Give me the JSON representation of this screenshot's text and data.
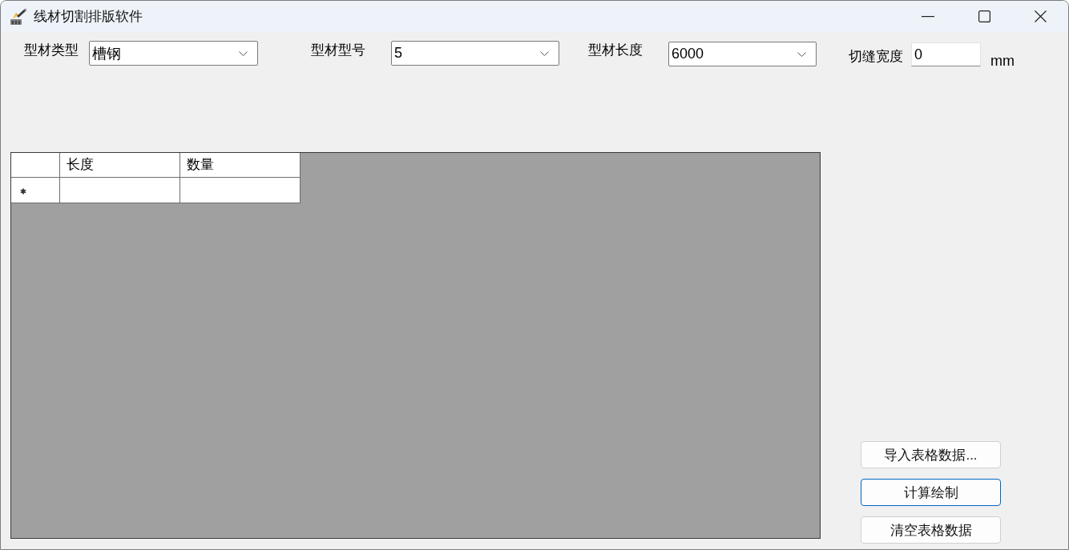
{
  "window": {
    "title": "线材切割排版软件"
  },
  "fields": [
    {
      "kind": "dropdown",
      "label": "型材类型",
      "value": "槽钢"
    },
    {
      "kind": "dropdown",
      "label": "型材型号",
      "value": "5"
    },
    {
      "kind": "dropdown",
      "label": "型材长度",
      "value": "6000"
    },
    {
      "kind": "text",
      "label": "切缝宽度",
      "value": "0",
      "unit": "mm"
    }
  ],
  "table": {
    "columns": [
      "长度",
      "数量"
    ],
    "rows": [
      {
        "new_row": true
      }
    ]
  },
  "buttons": [
    {
      "label": "导入表格数据...",
      "focused": false
    },
    {
      "label": "计算绘制",
      "focused": true
    },
    {
      "label": "清空表格数据",
      "focused": false
    }
  ]
}
